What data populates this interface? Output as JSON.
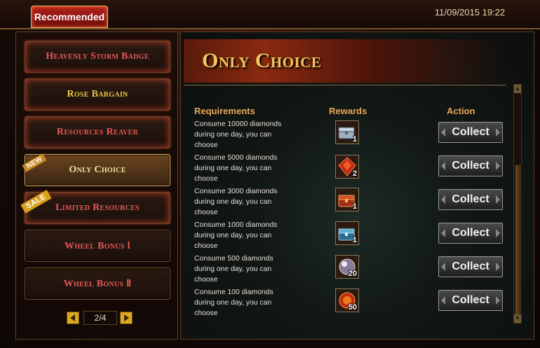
{
  "header": {
    "tab_label": "Recommended",
    "datetime": "11/09/2015 19:22"
  },
  "sidebar": {
    "items": [
      {
        "label": "Heavenly Storm Badge",
        "badge": ""
      },
      {
        "label": "Rose Bargain",
        "badge": ""
      },
      {
        "label": "Resources Reaver",
        "badge": ""
      },
      {
        "label": "Only Choice",
        "badge": "NEW"
      },
      {
        "label": "Limited Resources",
        "badge": "SALE"
      },
      {
        "label": "Wheel Bonus Ⅰ",
        "badge": ""
      },
      {
        "label": "Wheel Bonus Ⅱ",
        "badge": ""
      }
    ],
    "pager": {
      "value": "2/4"
    }
  },
  "panel": {
    "title": "Only Choice",
    "columns": {
      "requirements": "Requirements",
      "rewards": "Rewards",
      "action": "Action"
    },
    "rows": [
      {
        "requirement": "Consume 10000 diamonds during one day, you can choose",
        "reward_icon": "silver-chest-icon",
        "quantity": "1",
        "action": "Collect"
      },
      {
        "requirement": "Consume 5000 diamonds during one day, you can choose",
        "reward_icon": "fire-gem-icon",
        "quantity": "2",
        "action": "Collect"
      },
      {
        "requirement": "Consume 3000 diamonds during one day, you can choose",
        "reward_icon": "treasure-chest-icon",
        "quantity": "1",
        "action": "Collect"
      },
      {
        "requirement": "Consume 1000 diamonds during one day, you can choose",
        "reward_icon": "crystal-chest-icon",
        "quantity": "1",
        "action": "Collect"
      },
      {
        "requirement": "Consume 500 diamonds during one day, you can choose",
        "reward_icon": "pearl-orb-icon",
        "quantity": "20",
        "action": "Collect"
      },
      {
        "requirement": "Consume 100 diamonds during one day, you can choose",
        "reward_icon": "fire-orb-icon",
        "quantity": "50",
        "action": "Collect"
      }
    ]
  },
  "colors": {
    "accent": "#f4c460",
    "header_text": "#e8a65a",
    "active_tab": "#b0201a"
  }
}
